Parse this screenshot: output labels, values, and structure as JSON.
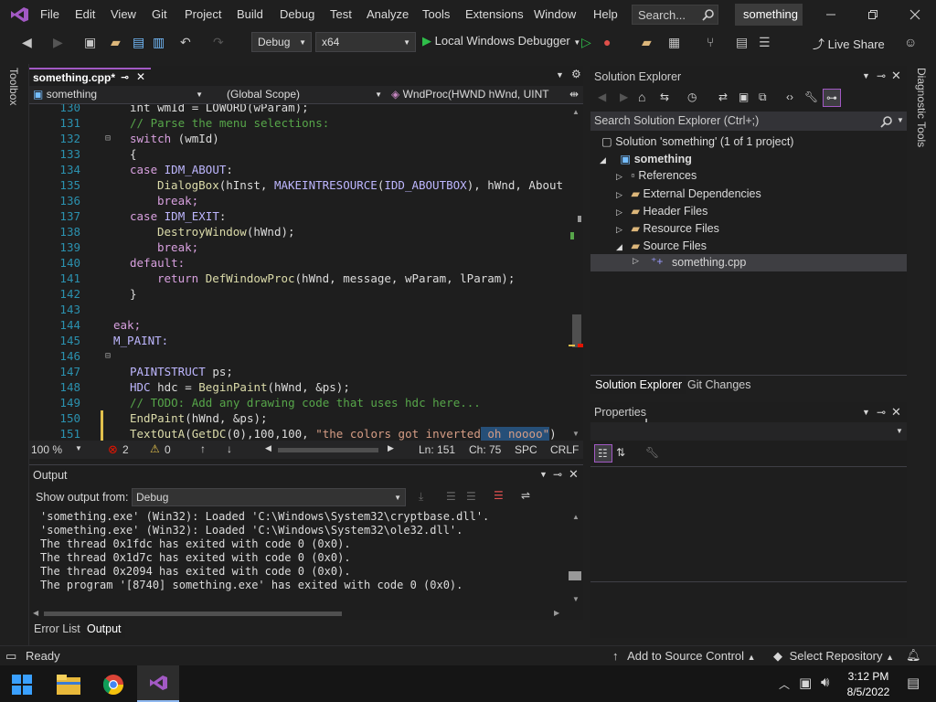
{
  "menu": [
    "File",
    "Edit",
    "View",
    "Git",
    "Project",
    "Build",
    "Debug",
    "Test",
    "Analyze",
    "Tools",
    "Extensions",
    "Window",
    "Help"
  ],
  "search_placeholder": "Search...",
  "solution_name": "something",
  "toolbar": {
    "config": "Debug",
    "platform": "x64",
    "run_label": "Local Windows Debugger",
    "live_share": "Live Share"
  },
  "side": {
    "toolbox": "Toolbox",
    "diagnostic": "Diagnostic Tools"
  },
  "doc_tab": "something.cpp*",
  "nav": {
    "project": "something",
    "scope": "(Global Scope)",
    "member": "WndProc(HWND hWnd, UINT"
  },
  "code": {
    "l130": {
      "n": "130",
      "t": "int wmId = LOWORD(wParam);"
    },
    "l131": {
      "n": "131",
      "t": "// Parse the menu selections:"
    },
    "l132": {
      "n": "132",
      "a": "switch",
      "b": " (wmId)"
    },
    "l133": {
      "n": "133",
      "t": "{"
    },
    "l134": {
      "n": "134",
      "a": "case ",
      "b": "IDM_ABOUT",
      "c": ":"
    },
    "l135": {
      "n": "135",
      "a": "DialogBox",
      "b": "(hInst, ",
      "c": "MAKEINTRESOURCE",
      "d": "(",
      "e": "IDD_ABOUTBOX",
      "f": "), hWnd, About"
    },
    "l136": {
      "n": "136",
      "t": "break;"
    },
    "l137": {
      "n": "137",
      "a": "case ",
      "b": "IDM_EXIT",
      "c": ":"
    },
    "l138": {
      "n": "138",
      "a": "DestroyWindow",
      "b": "(hWnd);"
    },
    "l139": {
      "n": "139",
      "t": "break;"
    },
    "l140": {
      "n": "140",
      "t": "default:"
    },
    "l141": {
      "n": "141",
      "a": "return ",
      "b": "DefWindowProc",
      "c": "(hWnd, message, wParam, lParam);"
    },
    "l142": {
      "n": "142",
      "t": "}"
    },
    "l143": {
      "n": "143",
      "t": ""
    },
    "l144": {
      "n": "144",
      "t": "eak;"
    },
    "l145": {
      "n": "145",
      "t": "M_PAINT:"
    },
    "l146": {
      "n": "146",
      "t": ""
    },
    "l147": {
      "n": "147",
      "a": "PAINTSTRUCT",
      "b": " ps;"
    },
    "l148": {
      "n": "148",
      "a": "HDC",
      "b": " hdc = ",
      "c": "BeginPaint",
      "d": "(hWnd, &ps);"
    },
    "l149": {
      "n": "149",
      "t": "// TODO: Add any drawing code that uses hdc here..."
    },
    "l150": {
      "n": "150",
      "a": "EndPaint",
      "b": "(hWnd, &ps);"
    },
    "l151": {
      "n": "151",
      "a": "TextOutA",
      "b": "(",
      "c": "GetDC",
      "d": "(0),100,100, ",
      "e": "\"the colors got inverted",
      "f": " oh noooo\"",
      "g": ")"
    }
  },
  "editor_status": {
    "zoom": "100 %",
    "errors": "2",
    "warnings": "0",
    "ln": "Ln: 151",
    "ch": "Ch: 75",
    "spc": "SPC",
    "crlf": "CRLF"
  },
  "output": {
    "title": "Output",
    "from_label": "Show output from:",
    "from_value": "Debug",
    "lines": [
      "'something.exe' (Win32): Loaded 'C:\\Windows\\System32\\cryptbase.dll'.",
      "'something.exe' (Win32): Loaded 'C:\\Windows\\System32\\ole32.dll'.",
      "The thread 0x1fdc has exited with code 0 (0x0).",
      "The thread 0x1d7c has exited with code 0 (0x0).",
      "The thread 0x2094 has exited with code 0 (0x0).",
      "The program '[8740] something.exe' has exited with code 0 (0x0)."
    ]
  },
  "bottom_tabs": {
    "error_list": "Error List",
    "output": "Output"
  },
  "solution_explorer": {
    "title": "Solution Explorer",
    "search": "Search Solution Explorer (Ctrl+;)",
    "solution": "Solution 'something' (1 of 1 project)",
    "project": "something",
    "items": [
      "References",
      "External Dependencies",
      "Header Files",
      "Resource Files",
      "Source Files"
    ],
    "file": "something.cpp",
    "tab_se": "Solution Explorer",
    "tab_git": "Git Changes"
  },
  "properties": {
    "title": "Properties"
  },
  "statusbar": {
    "ready": "Ready",
    "source_control": "Add to Source Control",
    "repository": "Select Repository"
  },
  "taskbar": {
    "time": "3:12 PM",
    "date": "8/5/2022"
  },
  "colors": {
    "accent": "#a259c4",
    "keyword": "#d8a0df",
    "comment": "#57a64a",
    "function": "#dcdcaa",
    "string": "#d69d85",
    "macro": "#beb7ff",
    "line_number": "#2b91af",
    "error": "#e51400"
  }
}
